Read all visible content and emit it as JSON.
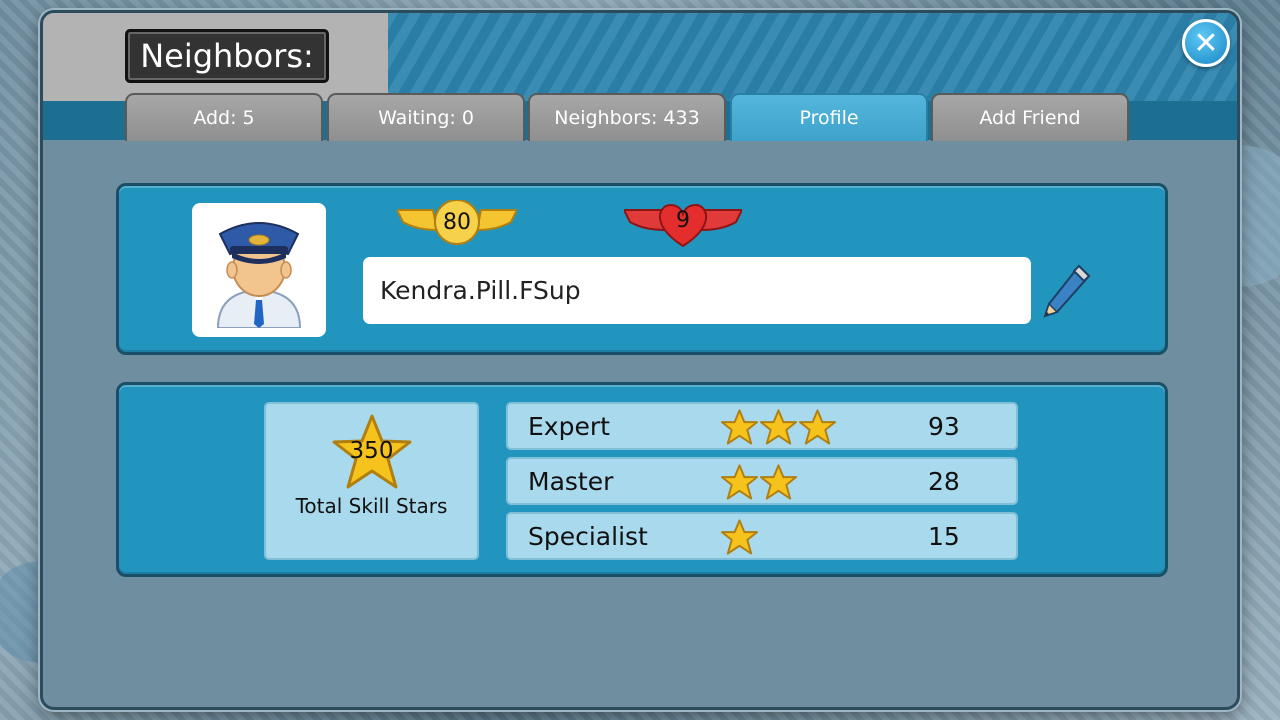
{
  "dialog": {
    "title": "Neighbors:",
    "tabs": [
      {
        "label": "Add: 5",
        "active": false
      },
      {
        "label": "Waiting: 0",
        "active": false
      },
      {
        "label": "Neighbors: 433",
        "active": false
      },
      {
        "label": "Profile",
        "active": true
      },
      {
        "label": "Add Friend",
        "active": false
      }
    ],
    "close_icon": "close-icon"
  },
  "profile": {
    "avatar_icon": "pilot-avatar-icon",
    "level": "80",
    "hearts": "9",
    "name": "Kendra.Pill.FSup",
    "edit_icon": "pencil-icon"
  },
  "skills": {
    "total_value": "350",
    "total_label": "Total Skill Stars",
    "rows": [
      {
        "name": "Expert",
        "stars": 3,
        "count": "93"
      },
      {
        "name": "Master",
        "stars": 2,
        "count": "28"
      },
      {
        "name": "Specialist",
        "stars": 1,
        "count": "15"
      }
    ]
  },
  "colors": {
    "panel": "#2295bf",
    "active_tab": "#3ea2cb",
    "inactive_tab": "#9a9a9a",
    "row_fill": "#a9d9ec",
    "star_gold": "#f6c21c"
  }
}
